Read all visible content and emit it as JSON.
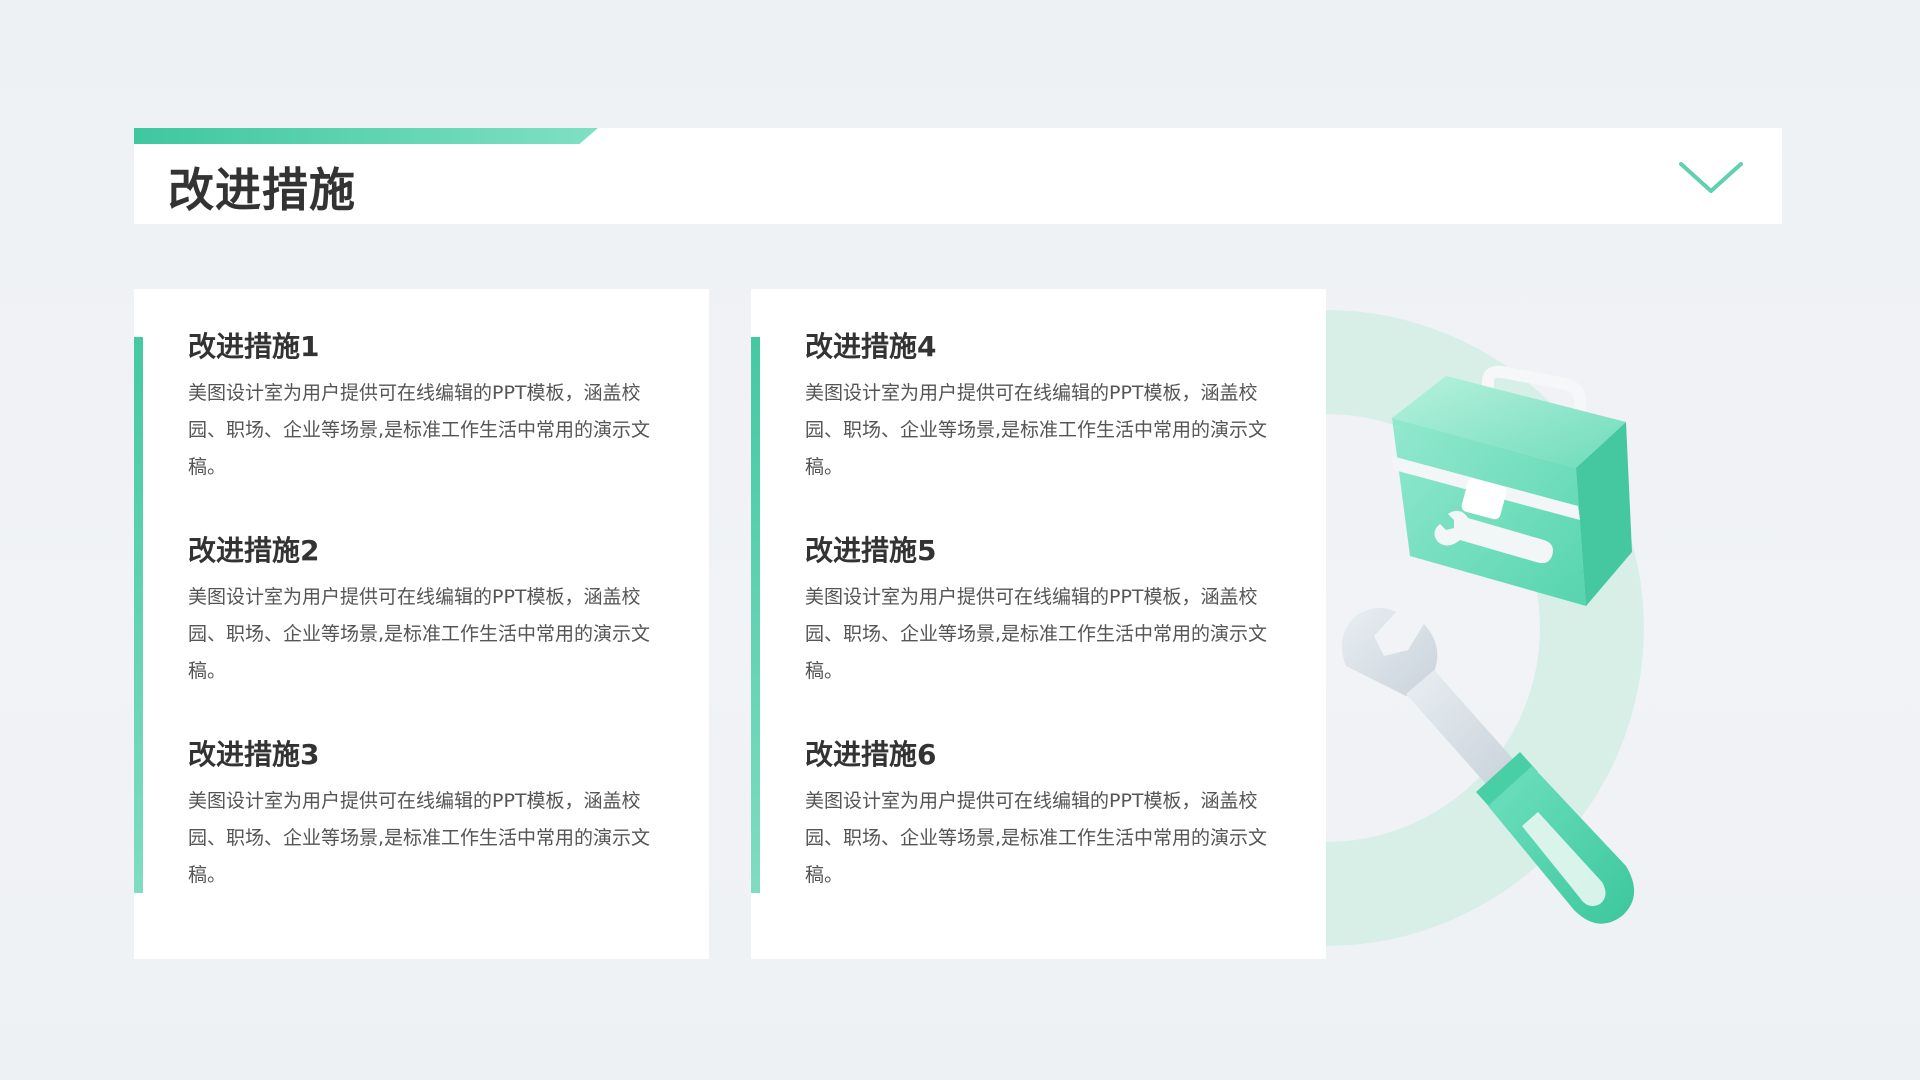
{
  "header": {
    "title": "改进措施"
  },
  "columns": [
    {
      "items": [
        {
          "title": "改进措施1",
          "desc": "美图设计室为用户提供可在线编辑的PPT模板，涵盖校园、职场、企业等场景,是标准工作生活中常用的演示文稿。"
        },
        {
          "title": "改进措施2",
          "desc": "美图设计室为用户提供可在线编辑的PPT模板，涵盖校园、职场、企业等场景,是标准工作生活中常用的演示文稿。"
        },
        {
          "title": "改进措施3",
          "desc": "美图设计室为用户提供可在线编辑的PPT模板，涵盖校园、职场、企业等场景,是标准工作生活中常用的演示文稿。"
        }
      ]
    },
    {
      "items": [
        {
          "title": "改进措施4",
          "desc": "美图设计室为用户提供可在线编辑的PPT模板，涵盖校园、职场、企业等场景,是标准工作生活中常用的演示文稿。"
        },
        {
          "title": "改进措施5",
          "desc": "美图设计室为用户提供可在线编辑的PPT模板，涵盖校园、职场、企业等场景,是标准工作生活中常用的演示文稿。"
        },
        {
          "title": "改进措施6",
          "desc": "美图设计室为用户提供可在线编辑的PPT模板，涵盖校园、职场、企业等场景,是标准工作生活中常用的演示文稿。"
        }
      ]
    }
  ],
  "icons": {
    "header_chevron": "chevron-down-icon",
    "illustration_toolbox": "toolbox-icon",
    "illustration_wrench": "wrench-icon"
  },
  "colors": {
    "accent": "#3fc7a0",
    "accent_light": "#7fe0c2",
    "text_dark": "#333333",
    "text_body": "#555555",
    "card_bg": "#ffffff"
  }
}
